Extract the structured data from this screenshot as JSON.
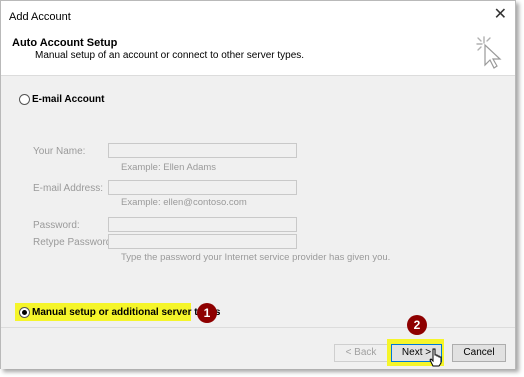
{
  "window": {
    "title": "Add Account"
  },
  "header": {
    "title": "Auto Account Setup",
    "subtitle": "Manual setup of an account or connect to other server types."
  },
  "email_option": {
    "label": "E-mail Account"
  },
  "fields": {
    "name": {
      "label": "Your Name:",
      "value": "",
      "example": "Example: Ellen Adams"
    },
    "email": {
      "label": "E-mail Address:",
      "value": "",
      "example": "Example: ellen@contoso.com"
    },
    "password": {
      "label": "Password:",
      "value": ""
    },
    "retype": {
      "label": "Retype Password:",
      "value": "",
      "hint": "Type the password your Internet service provider has given you."
    }
  },
  "manual_option": {
    "label": "Manual setup or additional server types",
    "selected": true
  },
  "callouts": {
    "one": "1",
    "two": "2"
  },
  "buttons": {
    "back": "< Back",
    "next": "Next >",
    "cancel": "Cancel"
  },
  "colors": {
    "highlight": "#f5f52a",
    "callout": "#8e0000"
  }
}
